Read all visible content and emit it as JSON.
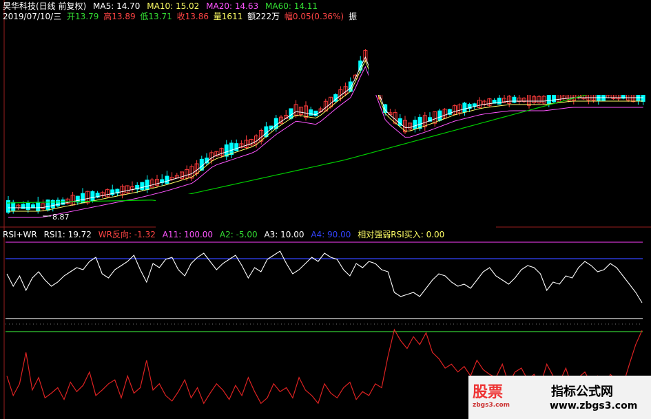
{
  "header": {
    "stock": "昊华科技(日线 前复权)",
    "ma5": "MA5: 14.70",
    "ma10": "MA10: 15.02",
    "ma20": "MA20: 14.63",
    "ma60": "MA60: 14.11",
    "date": "2019/07/10/三",
    "open": "开13.79",
    "high": "高13.89",
    "low": "低13.71",
    "close": "收13.86",
    "volume": "量1611",
    "amount": "额222万",
    "change": "幅0.05(0.36%)",
    "amp": "振"
  },
  "price_panel": {
    "low_marker": "8.87"
  },
  "indicator": {
    "name": "RSI+WR",
    "rsi1": "RSI1: 19.72",
    "wr": "WR反向: -1.32",
    "a11": "A11: 100.00",
    "a2": "A2: -5.00",
    "a3": "A3: 10.00",
    "a4": "A4: 90.00",
    "rsi_buy": "相对强弱RSI买入: 0.00"
  },
  "watermark": {
    "logo": "股票",
    "logo_sub": "zbgs3.com",
    "title": "指标公式网",
    "url": "www.zbgs3.com"
  },
  "colors": {
    "bg": "#000000",
    "up": "#ff3c3c",
    "down": "#00ffff",
    "ma5": "#ffffff",
    "ma10": "#ffff66",
    "ma20": "#ff55ff",
    "ma60": "#00cc00",
    "rsi": "#ffffff",
    "wr": "#dd2222"
  },
  "chart_data": [
    {
      "type": "line",
      "title": "RSI1",
      "values": [
        28,
        22,
        27,
        20,
        26,
        29,
        25,
        22,
        24,
        27,
        29,
        31,
        30,
        34,
        36,
        28,
        26,
        30,
        32,
        34,
        37,
        30,
        24,
        33,
        31,
        35,
        36,
        30,
        27,
        33,
        36,
        38,
        34,
        30,
        33,
        35,
        37,
        32,
        26,
        31,
        29,
        35,
        37,
        39,
        33,
        28,
        30,
        33,
        36,
        34,
        38,
        36,
        35,
        30,
        27,
        33,
        31,
        34,
        33,
        30,
        29,
        19,
        17,
        18,
        19,
        17,
        21,
        25,
        28,
        27,
        24,
        22,
        23,
        21,
        25,
        29,
        31,
        27,
        25,
        23,
        26,
        30,
        32,
        31,
        28,
        20,
        24,
        23,
        27,
        26,
        31,
        34,
        32,
        29,
        30,
        33,
        31,
        27,
        23,
        19,
        14
      ]
    },
    {
      "type": "line",
      "title": "WR反向",
      "values": [
        -60,
        -85,
        -70,
        -30,
        -78,
        -62,
        -88,
        -82,
        -75,
        -90,
        -68,
        -80,
        -72,
        -55,
        -85,
        -78,
        -70,
        -65,
        -88,
        -60,
        -82,
        -75,
        -40,
        -78,
        -70,
        -85,
        -92,
        -80,
        -65,
        -88,
        -75,
        -95,
        -82,
        -70,
        -78,
        -90,
        -72,
        -85,
        -62,
        -80,
        -95,
        -88,
        -70,
        -80,
        -75,
        -88,
        -62,
        -78,
        -85,
        -95,
        -70,
        -82,
        -88,
        -75,
        -68,
        -90,
        -80,
        -85,
        -70,
        -75,
        -35,
        -1,
        -15,
        -25,
        -10,
        -20,
        -5,
        -30,
        -38,
        -50,
        -45,
        -55,
        -48,
        -60,
        -40,
        -52,
        -58,
        -62,
        -45,
        -70,
        -55,
        -50,
        -65,
        -58,
        -72,
        -45,
        -60,
        -68,
        -50,
        -75,
        -62,
        -55,
        -70,
        -60,
        -80,
        -58,
        -65,
        -72,
        -45,
        -20,
        -2
      ]
    }
  ]
}
